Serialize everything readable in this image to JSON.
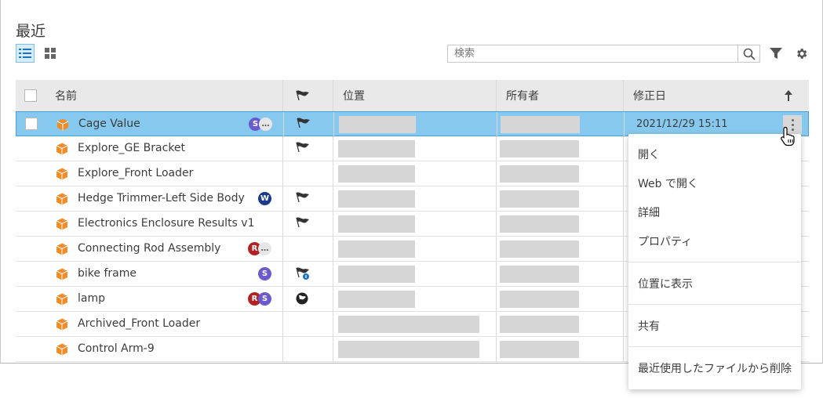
{
  "title": "最近",
  "search": {
    "placeholder": "検索"
  },
  "toolbar": {
    "list_view_icon": "list-view-icon",
    "grid_view_icon": "grid-view-icon",
    "filter_icon": "filter-icon",
    "settings_icon": "gear-icon"
  },
  "table": {
    "columns": {
      "name": "名前",
      "location": "位置",
      "owner": "所有者",
      "modified": "修正日"
    },
    "sort": "ascending",
    "rows": [
      {
        "name": "Cage Value",
        "badges": [
          "S",
          "…"
        ],
        "flag": "flag",
        "modified": "2021/12/29 15:11",
        "selected": true
      },
      {
        "name": "Explore_GE Bracket",
        "badges": [],
        "flag": "flag",
        "modified": ""
      },
      {
        "name": "Explore_Front Loader",
        "badges": [],
        "flag": "",
        "modified": ""
      },
      {
        "name": "Hedge Trimmer-Left Side Body",
        "badges": [
          "W"
        ],
        "flag": "flag",
        "modified": ""
      },
      {
        "name": "Electronics Enclosure Results v1",
        "badges": [],
        "flag": "flag",
        "modified": ""
      },
      {
        "name": "Connecting Rod Assembly",
        "badges": [
          "R",
          "…"
        ],
        "flag": "",
        "modified": ""
      },
      {
        "name": "bike frame",
        "badges": [
          "S"
        ],
        "flag": "flag-info",
        "modified": ""
      },
      {
        "name": "lamp",
        "badges": [
          "R",
          "S"
        ],
        "flag": "flag-circle",
        "modified": ""
      },
      {
        "name": "Archived_Front Loader",
        "badges": [],
        "flag": "",
        "modified": ""
      },
      {
        "name": "Control Arm-9",
        "badges": [],
        "flag": "",
        "modified": ""
      }
    ]
  },
  "context_menu": {
    "open": "開く",
    "open_web": "Web で開く",
    "details": "詳細",
    "properties": "プロパティ",
    "show_location": "位置に表示",
    "share": "共有",
    "remove_recent": "最近使用したファイルから削除"
  },
  "colors": {
    "accent": "#87c9ee",
    "cube": "#f28c28",
    "badge_s": "#6a5acd",
    "badge_w": "#1a3a8a",
    "badge_r": "#b22222"
  }
}
